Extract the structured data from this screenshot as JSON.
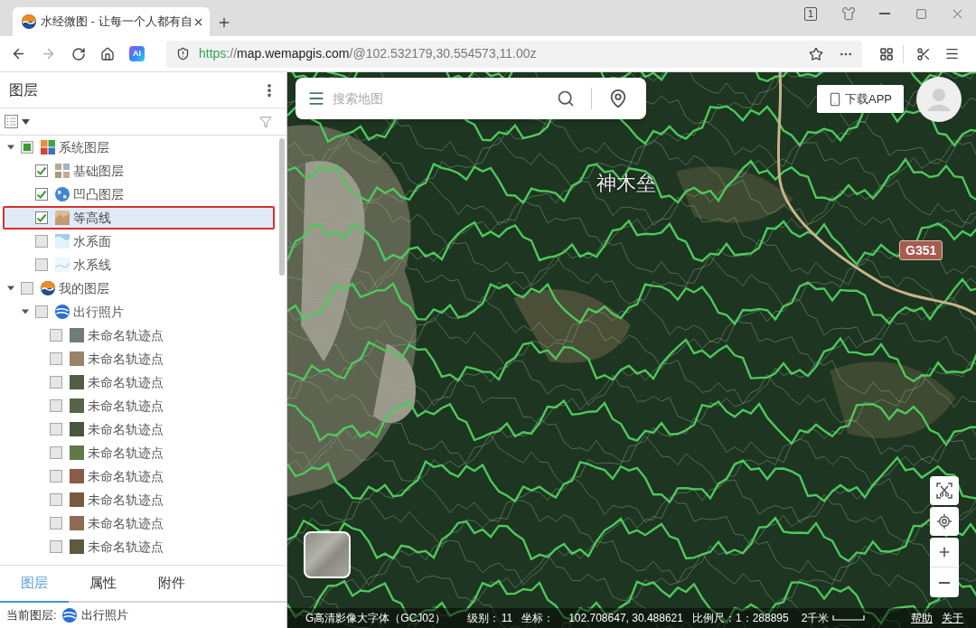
{
  "browser": {
    "tab_title": "水经微图 - 让每一个人都有自",
    "tab_count": "1",
    "ai_label": "AI",
    "forward_disabled": true,
    "url": [
      {
        "text": "https",
        "kind": "scheme"
      },
      {
        "text": "://",
        "kind": "path"
      },
      {
        "text": "map.wemapgis.com",
        "kind": "host"
      },
      {
        "text": "/@102.532179,30.554573,11.00z",
        "kind": "path"
      }
    ]
  },
  "layers_panel": {
    "title": "图层",
    "tree": [
      {
        "label": "系统图层",
        "checked": false,
        "indeterminate": true,
        "selected": false,
        "expanded": true,
        "children": [
          {
            "label": "基础图层",
            "checked": true,
            "indeterminate": false,
            "selected": false
          },
          {
            "label": "凹凸图层",
            "checked": true,
            "indeterminate": false,
            "selected": false
          },
          {
            "label": "等高线",
            "checked": true,
            "indeterminate": false,
            "selected": true
          },
          {
            "label": "水系面",
            "checked": false,
            "indeterminate": false,
            "selected": false
          },
          {
            "label": "水系线",
            "checked": false,
            "indeterminate": false,
            "selected": false
          }
        ]
      },
      {
        "label": "我的图层",
        "checked": false,
        "indeterminate": false,
        "selected": false,
        "expanded": true,
        "children": [
          {
            "label": "出行照片",
            "checked": false,
            "indeterminate": false,
            "selected": false,
            "expanded": true,
            "children": [
              {
                "label": "未命名轨迹点",
                "checked": false,
                "indeterminate": false,
                "selected": false
              },
              {
                "label": "未命名轨迹点",
                "checked": false,
                "indeterminate": false,
                "selected": false
              },
              {
                "label": "未命名轨迹点",
                "checked": false,
                "indeterminate": false,
                "selected": false
              },
              {
                "label": "未命名轨迹点",
                "checked": false,
                "indeterminate": false,
                "selected": false
              },
              {
                "label": "未命名轨迹点",
                "checked": false,
                "indeterminate": false,
                "selected": false
              },
              {
                "label": "未命名轨迹点",
                "checked": false,
                "indeterminate": false,
                "selected": false
              },
              {
                "label": "未命名轨迹点",
                "checked": false,
                "indeterminate": false,
                "selected": false
              },
              {
                "label": "未命名轨迹点",
                "checked": false,
                "indeterminate": false,
                "selected": false
              },
              {
                "label": "未命名轨迹点",
                "checked": false,
                "indeterminate": false,
                "selected": false
              },
              {
                "label": "未命名轨迹点",
                "checked": false,
                "indeterminate": false,
                "selected": false
              }
            ]
          }
        ]
      }
    ],
    "tabs": [
      {
        "label": "图层",
        "selected": true
      },
      {
        "label": "属性",
        "selected": false
      },
      {
        "label": "附件",
        "selected": false
      }
    ],
    "current_layer": {
      "label": "当前图层:",
      "value": "出行照片"
    }
  },
  "map": {
    "search": {
      "placeholder": "搜索地图"
    },
    "download_label": "下载APP",
    "labels": [
      {
        "text": "神木垒",
        "kind": "place"
      },
      {
        "text": "G351",
        "kind": "road"
      }
    ],
    "status_bar": {
      "basemap": "G高清影像大字体（GCJ02）",
      "fields": [
        {
          "label": "级别：",
          "value": "11"
        },
        {
          "label": "坐标：",
          "value": "102.708647, 30.488621"
        },
        {
          "label": "比例尺：",
          "value": "1：288895"
        }
      ],
      "scale": "2千米",
      "links": [
        "帮助",
        "关于"
      ]
    }
  }
}
